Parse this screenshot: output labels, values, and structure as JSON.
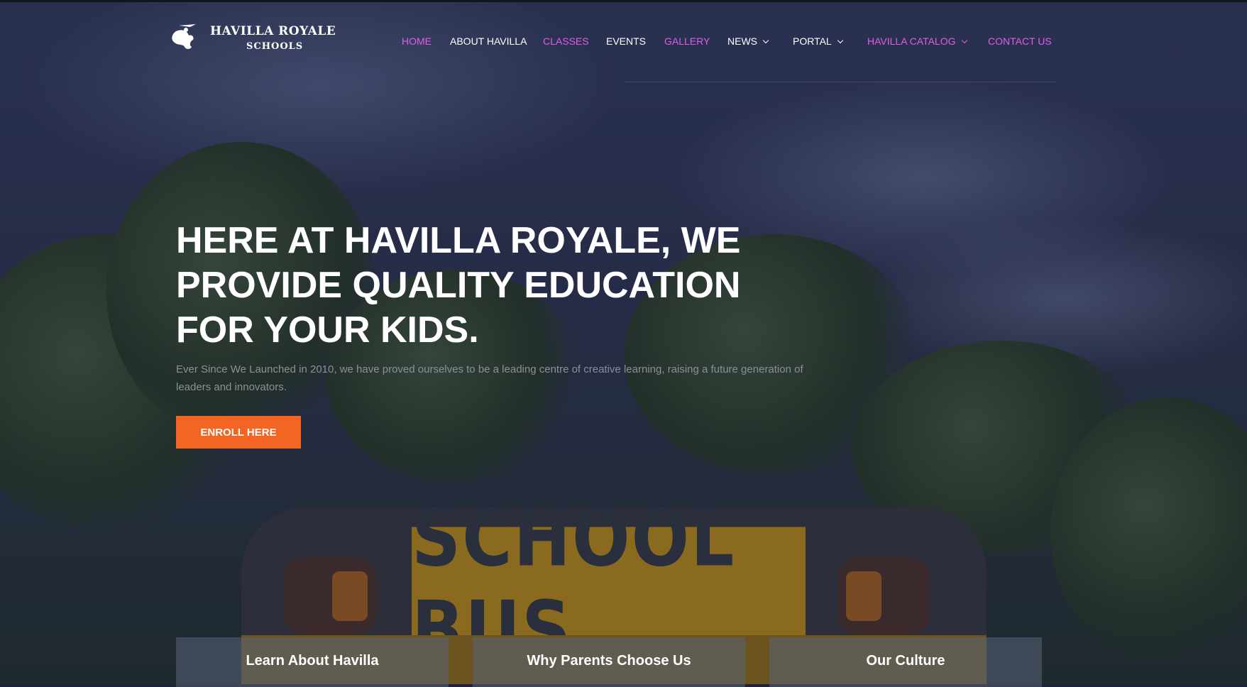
{
  "brand": {
    "name_line1": "HAVILLA ROYALE",
    "name_line2": "SCHOOLS"
  },
  "nav": {
    "items": [
      {
        "label": "HOME",
        "color": "#e05de8",
        "has_dropdown": false
      },
      {
        "label": "ABOUT HAVILLA",
        "color": "#ffffff",
        "has_dropdown": false
      },
      {
        "label": "CLASSES",
        "color": "#e05de8",
        "has_dropdown": false
      },
      {
        "label": "EVENTS",
        "color": "#ffffff",
        "has_dropdown": false
      },
      {
        "label": "GALLERY",
        "color": "#e05de8",
        "has_dropdown": false
      },
      {
        "label": "NEWS",
        "color": "#ffffff",
        "has_dropdown": true
      },
      {
        "label": "PORTAL",
        "color": "#ffffff",
        "has_dropdown": true
      },
      {
        "label": "HAVILLA CATALOG",
        "color": "#e05de8",
        "has_dropdown": true
      },
      {
        "label": "CONTACT US",
        "color": "#e05de8",
        "has_dropdown": false
      }
    ]
  },
  "hero": {
    "headline": "HERE AT HAVILLA ROYALE, WE PROVIDE QUALITY EDUCATION FOR YOUR KIDS.",
    "subtext": "Ever Since We Launched in 2010, we have proved ourselves to be a leading centre of creative learning, raising a future generation of leaders and innovators.",
    "cta_label": "ENROLL HERE",
    "cta_color": "#f26522",
    "background_sign_text": "SCHOOL BUS"
  },
  "cards": [
    {
      "title": "Learn About Havilla"
    },
    {
      "title": "Why Parents Choose Us"
    },
    {
      "title": "Our Culture"
    }
  ],
  "icons": {
    "logo": "school-emblem-icon",
    "dropdown": "chevron-down-icon"
  }
}
